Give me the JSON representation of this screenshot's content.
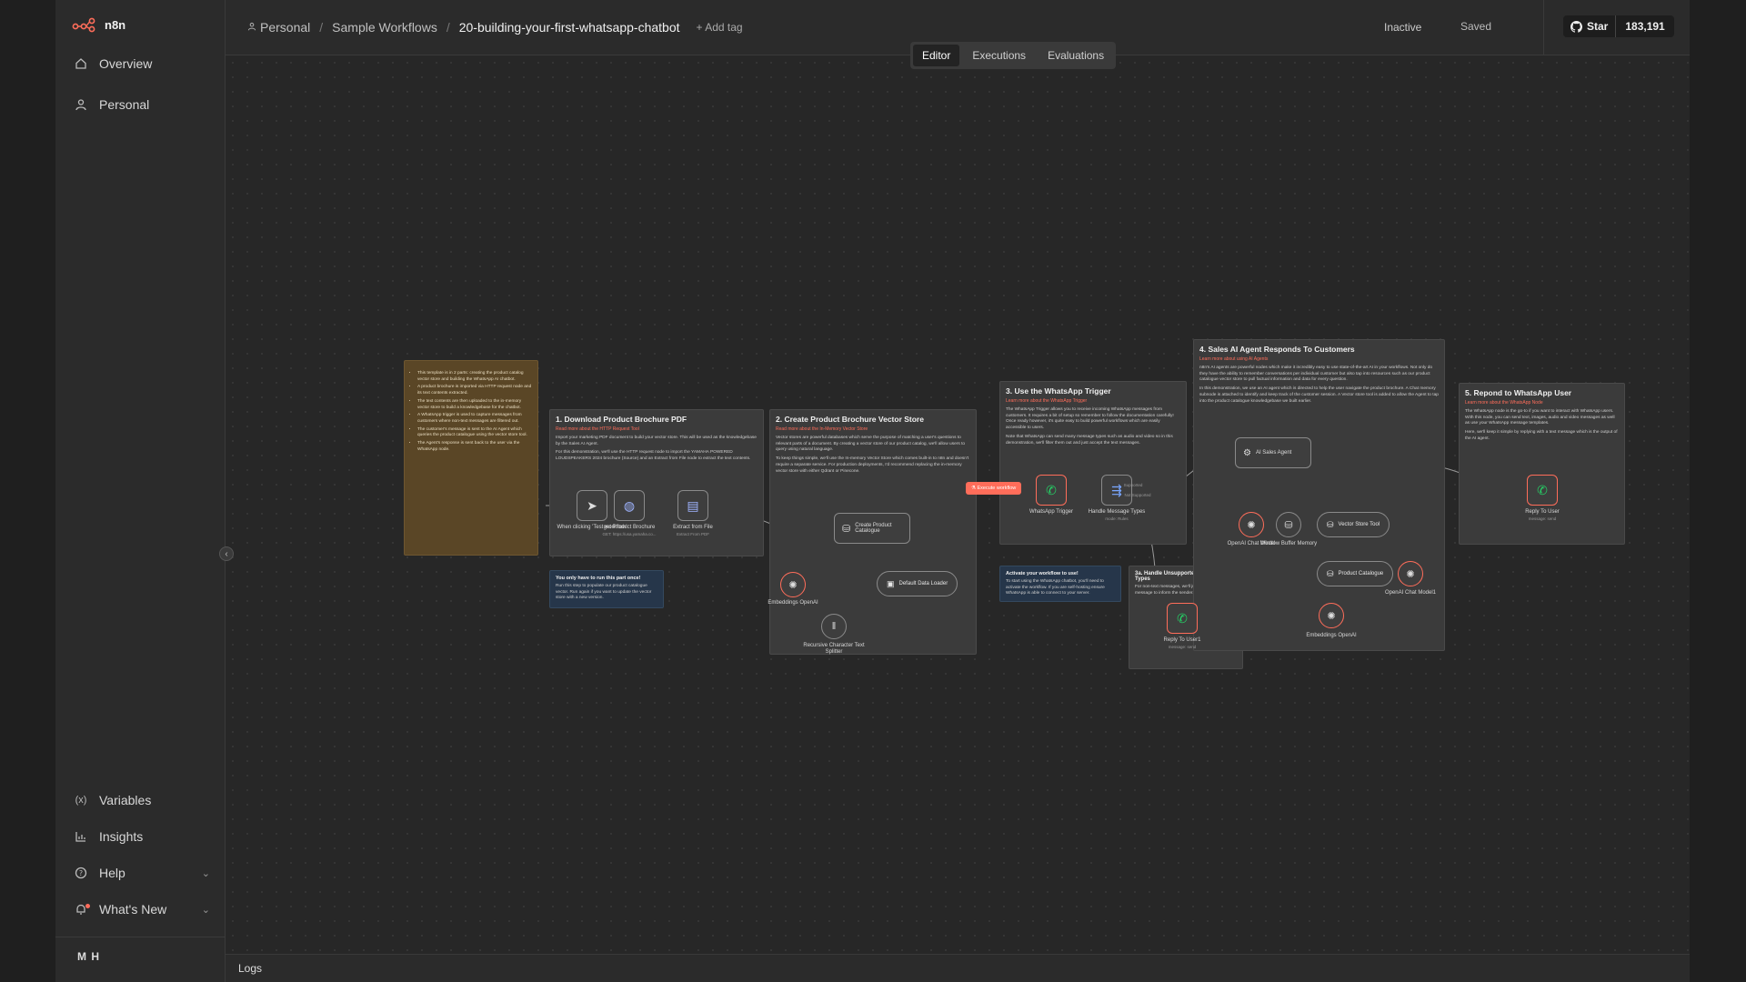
{
  "app": {
    "brand": "n8n"
  },
  "sidebar": {
    "items": [
      {
        "label": "Overview",
        "icon": "home-icon"
      },
      {
        "label": "Personal",
        "icon": "user-icon"
      }
    ],
    "bottom_items": [
      {
        "label": "Variables",
        "icon": "variables-icon"
      },
      {
        "label": "Insights",
        "icon": "chart-icon"
      },
      {
        "label": "Help",
        "icon": "help-icon"
      },
      {
        "label": "What's New",
        "icon": "bell-icon"
      }
    ],
    "user_initials": "M H"
  },
  "header": {
    "breadcrumbs": [
      "Personal",
      "Sample Workflows",
      "20-building-your-first-whatsapp-chatbot"
    ],
    "add_tag": "+ Add tag",
    "status": "Inactive",
    "save_state": "Saved",
    "github_star": "Star",
    "github_count": "183,191"
  },
  "tabs": [
    {
      "label": "Editor",
      "active": true
    },
    {
      "label": "Executions",
      "active": false
    },
    {
      "label": "Evaluations",
      "active": false
    }
  ],
  "notes": {
    "intro": [
      "This template is in 2 parts: creating the product catalog vector store and building the WhatsApp AI chatbot.",
      "A product brochure is imported via HTTP request node and its text contents extracted.",
      "The text contents are then uploaded to the in-memory vector store to build a knowledgebase for the chatbot.",
      "A WhatsApp trigger is used to capture messages from customers where non-text messages are filtered out.",
      "The customer's message is sent to the AI Agent which queries the product catalogue using the vector store tool.",
      "The Agent's response is sent back to the user via the WhatsApp node."
    ],
    "step1": {
      "title": "1. Download Product Brochure PDF",
      "link": "Read more about the HTTP Request Tool",
      "p1": "Import your marketing PDF document to build your vector store. This will be used as the knowledgebase by the Sales AI Agent.",
      "p2": "For this demonstration, we'll use the HTTP request node to import the YAMAHA POWERED LOUDSPEAKERS 2024 brochure (Source) and an Extract from File node to extract the text contents."
    },
    "step2": {
      "title": "2. Create Product Brochure Vector Store",
      "link": "Read more about the In-Memory Vector Store",
      "p1": "Vector stores are powerful databases which serve the purpose of matching a user's questions to relevant parts of a document. By creating a vector store of our product catalog, we'll allow users to query using natural language.",
      "p2": "To keep things simple, we'll use the In-memory Vector Store which comes built-in to n8n and doesn't require a separate service. For production deployments, I'd recommend replacing the in-memory vector store with either Qdrant or Pinecone."
    },
    "step3": {
      "title": "3. Use the WhatsApp Trigger",
      "link": "Learn more about the WhatsApp Trigger",
      "p1": "The WhatsApp Trigger allows you to receive incoming WhatsApp messages from customers. It requires a bit of setup so remember to follow the documentation carefully! Once ready however, it's quite easy to build powerful workflows which are easily accessible to users.",
      "p2": "Note that WhatsApp can send many message types such as audio and video so in this demonstration, we'll filter them out and just accept the text messages."
    },
    "step3a": {
      "title": "3a. Handle Unsupported Message Types",
      "p1": "For non-text messages, we'll just reply with a simple message to inform the sender."
    },
    "step4": {
      "title": "4. Sales AI Agent Responds To Customers",
      "link": "Learn more about using AI Agents",
      "p1": "n8n's AI agents are powerful nodes which make it incredibly easy to use state-of-the-art AI in your workflows. Not only do they have the ability to remember conversations per individual customer but also tap into resources such as our product catalogue vector store to pull factual information and data for every question.",
      "p2": "In this demonstration, we use an AI agent which is directed to help the user navigate the product brochure. A Chat memory subnode is attached to identify and keep track of the customer session. A Vector store tool is added to allow the Agent to tap into the product catalogue knowledgebase we built earlier."
    },
    "step5": {
      "title": "5. Repond to WhatsApp User",
      "link": "Learn more about the WhatsApp Node",
      "p1": "The WhatsApp node is the go-to if you want to interact with WhatsApp users. With this node, you can send text, images, audio and video messages as well as use your WhatsApp message templates.",
      "p2": "Here, we'll keep it simple by replying with a text message which is the output of the AI agent."
    },
    "once": {
      "title": "You only have to run this part once!",
      "p1": "Run this step to populate our product catalogue vector. Run again if you want to update the vector store with a new version."
    },
    "activate": {
      "title": "Activate your workflow to use!",
      "p1": "To start using the WhatsApp chatbot, you'll need to activate the workflow. If you are self-hosting ensure WhatsApp is able to connect to your server."
    }
  },
  "nodes": {
    "manual": {
      "label": "When clicking 'Test workflow'"
    },
    "http": {
      "label": "get Product Brochure",
      "sub": "GET: https://usa.yamaha.co..."
    },
    "extract": {
      "label": "Extract from File",
      "sub": "Extract From PDF"
    },
    "catalogue": {
      "label": "Create Product Catalogue"
    },
    "embeddings1": {
      "label": "Embeddings OpenAI"
    },
    "loader": {
      "label": "Default Data Loader"
    },
    "splitter": {
      "label": "Recursive Character Text Splitter"
    },
    "exec": {
      "label": "Execute workflow"
    },
    "wa_trigger": {
      "label": "WhatsApp Trigger"
    },
    "switch": {
      "label": "Handle Message Types",
      "sub": "mode: Rules"
    },
    "reply1": {
      "label": "Reply To User1",
      "sub": "message: send"
    },
    "agent": {
      "label": "AI Sales Agent"
    },
    "chat_model": {
      "label": "OpenAI Chat Model"
    },
    "memory": {
      "label": "Window Buffer Memory"
    },
    "vector_tool": {
      "label": "Vector Store Tool"
    },
    "product_cat": {
      "label": "Product Catalogue"
    },
    "chat_model1": {
      "label": "OpenAI Chat Model1"
    },
    "embeddings2": {
      "label": "Embeddings OpenAI"
    },
    "reply": {
      "label": "Reply To User",
      "sub": "message: send"
    },
    "switch_out": {
      "supported": "Supported",
      "unsupported": "Not Supported"
    }
  },
  "logs": {
    "label": "Logs"
  },
  "colors": {
    "accent": "#ff6d5a",
    "bg": "#272727"
  }
}
